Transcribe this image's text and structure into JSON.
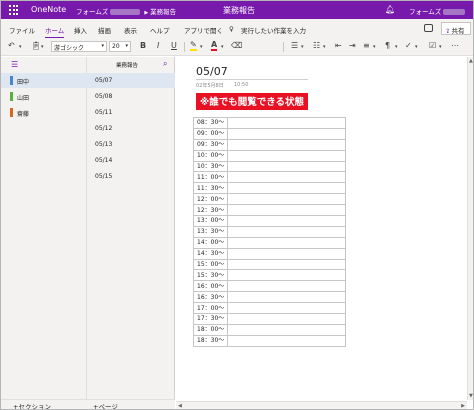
{
  "titlebar": {
    "app_name": "OneNote",
    "breadcrumb_1": "フォームズ",
    "breadcrumb_2": "業務報告",
    "document_title": "業務報告",
    "user_name": "フォームズ"
  },
  "menu": {
    "tabs": [
      "ファイル",
      "ホーム",
      "挿入",
      "描画",
      "表示",
      "ヘルプ",
      "アプリで開く",
      "実行したい作業を入力"
    ],
    "active_tab": "ホーム",
    "share_label": "共有"
  },
  "toolbar": {
    "font_name": "游ゴシック",
    "font_size": "20",
    "bold": "B",
    "italic": "I",
    "underline": "U",
    "highlight_color": "#ffe000",
    "font_color": "#e81123"
  },
  "notebook": {
    "name": "業務報告",
    "sections": [
      {
        "label": "田中",
        "color": "#4a86c5"
      },
      {
        "label": "山田",
        "color": "#5ab041"
      },
      {
        "label": "齋藤",
        "color": "#d2691e"
      }
    ],
    "selected_section": "田中",
    "pages": [
      "05/07",
      "05/08",
      "05/11",
      "05/12",
      "05/13",
      "05/14",
      "05/15"
    ],
    "selected_page": "05/07",
    "add_section_label": "+セクション",
    "add_page_label": "+ページ"
  },
  "page": {
    "title": "05/07",
    "date": "02年5月8日",
    "time": "10:50",
    "note": "※誰でも閲覧できる状態",
    "note_color": "#e81123",
    "schedule_times": [
      "08：30～",
      "09：00～",
      "09：30～",
      "10：00～",
      "10：30～",
      "11：00～",
      "11：30～",
      "12：00～",
      "12：30～",
      "13：00～",
      "13：30～",
      "14：00～",
      "14：30～",
      "15：00～",
      "15：30～",
      "16：00～",
      "16：30～",
      "17：00～",
      "17：30～",
      "18：00～",
      "18：30～"
    ]
  },
  "colors": {
    "brand": "#7719aa",
    "chrome": "#f3f2f1",
    "selection": "#dde6f1"
  }
}
